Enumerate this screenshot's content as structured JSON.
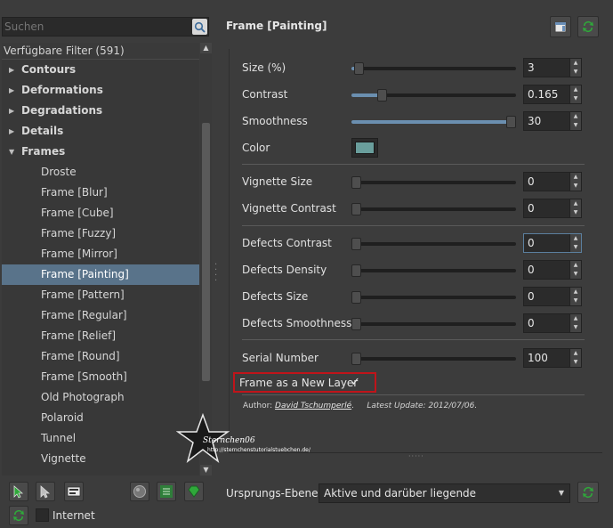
{
  "search": {
    "placeholder": "Suchen"
  },
  "tree": {
    "header": "Verfügbare Filter (591)",
    "categories": [
      {
        "label": "Contours",
        "expanded": false
      },
      {
        "label": "Deformations",
        "expanded": false
      },
      {
        "label": "Degradations",
        "expanded": false
      },
      {
        "label": "Details",
        "expanded": false
      },
      {
        "label": "Frames",
        "expanded": true
      }
    ],
    "items": [
      "Droste",
      "Frame [Blur]",
      "Frame [Cube]",
      "Frame [Fuzzy]",
      "Frame [Mirror]",
      "Frame [Painting]",
      "Frame [Pattern]",
      "Frame [Regular]",
      "Frame [Relief]",
      "Frame [Round]",
      "Frame [Smooth]",
      "Old Photograph",
      "Polaroid",
      "Tunnel",
      "Vignette"
    ],
    "selected": "Frame [Painting]"
  },
  "internet": {
    "label": "Internet",
    "checked": false
  },
  "filter": {
    "title": "Frame [Painting]",
    "params": {
      "size": {
        "label": "Size (%)",
        "value": "3",
        "level": 0.02
      },
      "contrast": {
        "label": "Contrast",
        "value": "0.165",
        "level": 0.165
      },
      "smoothness": {
        "label": "Smoothness",
        "value": "30",
        "level": 1.0
      },
      "color": {
        "label": "Color",
        "swatch": "#6a9e9c"
      },
      "vignette_size": {
        "label": "Vignette Size",
        "value": "0",
        "level": 0
      },
      "vignette_contrast": {
        "label": "Vignette Contrast",
        "value": "0",
        "level": 0
      },
      "defects_contrast": {
        "label": "Defects Contrast",
        "value": "0",
        "level": 0
      },
      "defects_density": {
        "label": "Defects Density",
        "value": "0",
        "level": 0
      },
      "defects_size": {
        "label": "Defects Size",
        "value": "0",
        "level": 0
      },
      "defects_smoothness": {
        "label": "Defects Smoothness",
        "value": "0",
        "level": 0
      },
      "serial_number": {
        "label": "Serial Number",
        "value": "100",
        "level": 0
      }
    },
    "new_layer": {
      "label": "Frame as a New Layer",
      "checked": true,
      "check_glyph": "✓"
    },
    "author": {
      "prefix": "Author: ",
      "name": "David Tschumperlé",
      "suffix": ".",
      "update": "Latest Update: 2012/07/06."
    }
  },
  "bottom": {
    "source_label": "Ursprungs-Ebenen",
    "source_value": "Aktive und darüber liegende"
  },
  "watermark": {
    "name": "Sternchen06",
    "url": "http://sternchenstutorialstuebchen.de/"
  },
  "colors": {
    "background": "#3c3c3c",
    "selection": "#59738a",
    "slider_fill": "#6b8fb0",
    "highlight_box": "#c0141a",
    "green_icon": "#2fa83a"
  }
}
